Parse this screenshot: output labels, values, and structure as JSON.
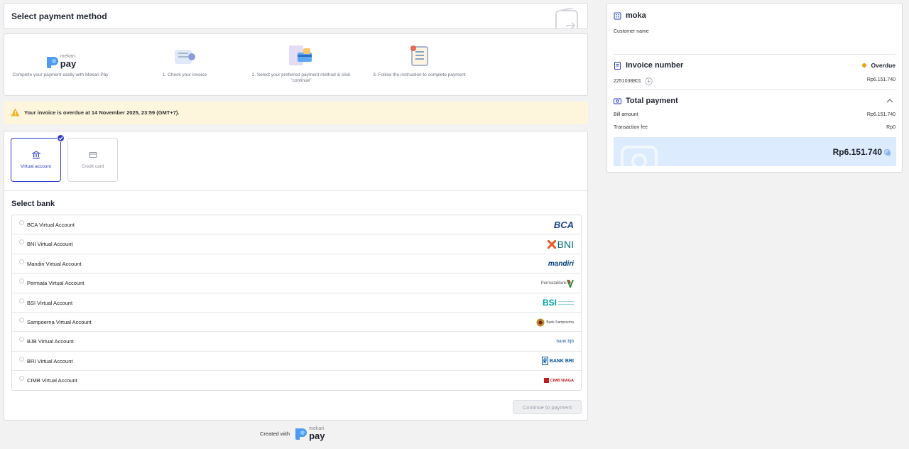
{
  "header": {
    "title": "Select payment method",
    "wallet_icon": "wallet-icon"
  },
  "steps": [
    {
      "text": "Complete your payment easily with Mekari Pay",
      "icon": "mekari-pay-logo"
    },
    {
      "text": "1. Check your invoice",
      "icon": "invoice-illustration"
    },
    {
      "text": "2. Select your preferred payment method & click \"continue\"",
      "icon": "payment-method-illustration"
    },
    {
      "text": "3. Follow the instruction to complete payment",
      "icon": "instruction-illustration"
    }
  ],
  "brand": {
    "word_top": "mekari",
    "word_bottom": "pay"
  },
  "banner": {
    "text": "Your invoice is overdue at 14 November 2025, 23:59 (GMT+7)."
  },
  "methods": [
    {
      "label": "Virtual account",
      "selected": true,
      "icon": "bank-icon"
    },
    {
      "label": "Credit card",
      "selected": false,
      "icon": "credit-card-icon"
    }
  ],
  "bank_section": {
    "title": "Select bank"
  },
  "banks": [
    {
      "name": "BCA Virtual Account",
      "logo": "BCA"
    },
    {
      "name": "BNI Virtual Account",
      "logo": "BNI"
    },
    {
      "name": "Mandiri Virtual Account",
      "logo": "mandiri"
    },
    {
      "name": "Permata Virtual Account",
      "logo": "PermataBank"
    },
    {
      "name": "BSI Virtual Account",
      "logo": "BSI"
    },
    {
      "name": "Sampoerna Virtual Account",
      "logo": "Bank Sampoerna"
    },
    {
      "name": "BJB Virtual Account",
      "logo": "bank bjb"
    },
    {
      "name": "BRI Virtual Account",
      "logo": "BANK BRI"
    },
    {
      "name": "CIMB Virtual Account",
      "logo": "CIMB NIAGA"
    }
  ],
  "continue_label": "Continue to payment",
  "footer": {
    "text": "Created with"
  },
  "side": {
    "customer": {
      "name": "moka",
      "label": "Customer name"
    },
    "invoice": {
      "title": "Invoice number",
      "status": "Overdue",
      "number": "2251038801",
      "amount": "Rp6.151.740"
    },
    "total": {
      "title": "Total payment",
      "bill_label": "Bill amount",
      "bill_value": "Rp6.151.740",
      "fee_label": "Transaction fee",
      "fee_value": "Rp0",
      "grand_total": "Rp6.151.740"
    }
  },
  "colors": {
    "accent": "#2a3cc7",
    "overdue_dot": "#f59e0b",
    "banner_bg": "#fdf5dc",
    "total_bg": "#dcebfd"
  }
}
